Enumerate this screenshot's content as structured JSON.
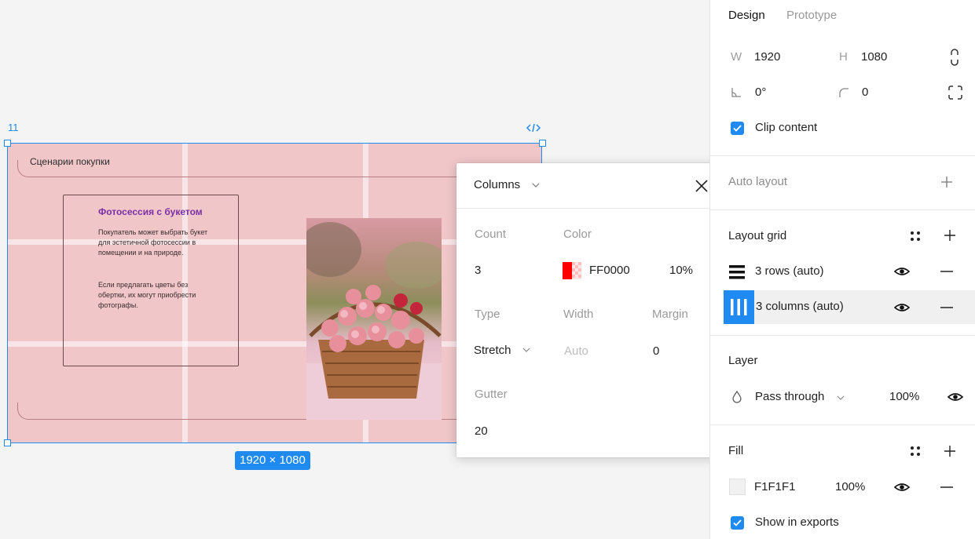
{
  "canvas": {
    "frame_label": "11",
    "frame_dims_badge": "1920 × 1080",
    "design": {
      "scenario_title": "Сценарии покупки",
      "card_title": "Фотосессия с букетом",
      "card_par_1": "Покупатель может выбрать букет для эстетичной фотосессии в помещении и на природе.",
      "card_par_2": "Если предлагать цветы без обертки, их могут приобрести фотографы."
    }
  },
  "popup": {
    "title": "Columns",
    "count_label": "Count",
    "count_value": "3",
    "color_label": "Color",
    "color_hex": "FF0000",
    "color_opacity": "10%",
    "color_value": "#FF0000",
    "type_label": "Type",
    "type_value": "Stretch",
    "width_label": "Width",
    "width_placeholder": "Auto",
    "margin_label": "Margin",
    "margin_value": "0",
    "gutter_label": "Gutter",
    "gutter_value": "20"
  },
  "panel": {
    "tabs": {
      "design": "Design",
      "prototype": "Prototype"
    },
    "w_label": "W",
    "w_value": "1920",
    "h_label": "H",
    "h_value": "1080",
    "rotation_value": "0°",
    "radius_value": "0",
    "clip_content_label": "Clip content",
    "auto_layout_title": "Auto layout",
    "layout_grid_title": "Layout grid",
    "grids": [
      {
        "label": "3 rows (auto)",
        "icon": "rows-grid-icon"
      },
      {
        "label": "3 columns (auto)",
        "icon": "columns-grid-icon"
      }
    ],
    "layer_title": "Layer",
    "layer_blend": "Pass through",
    "layer_opacity": "100%",
    "fill_title": "Fill",
    "fill_hex": "F1F1F1",
    "fill_opacity": "100%",
    "show_in_exports_label": "Show in exports",
    "accent_color": "#1F8BF2"
  }
}
